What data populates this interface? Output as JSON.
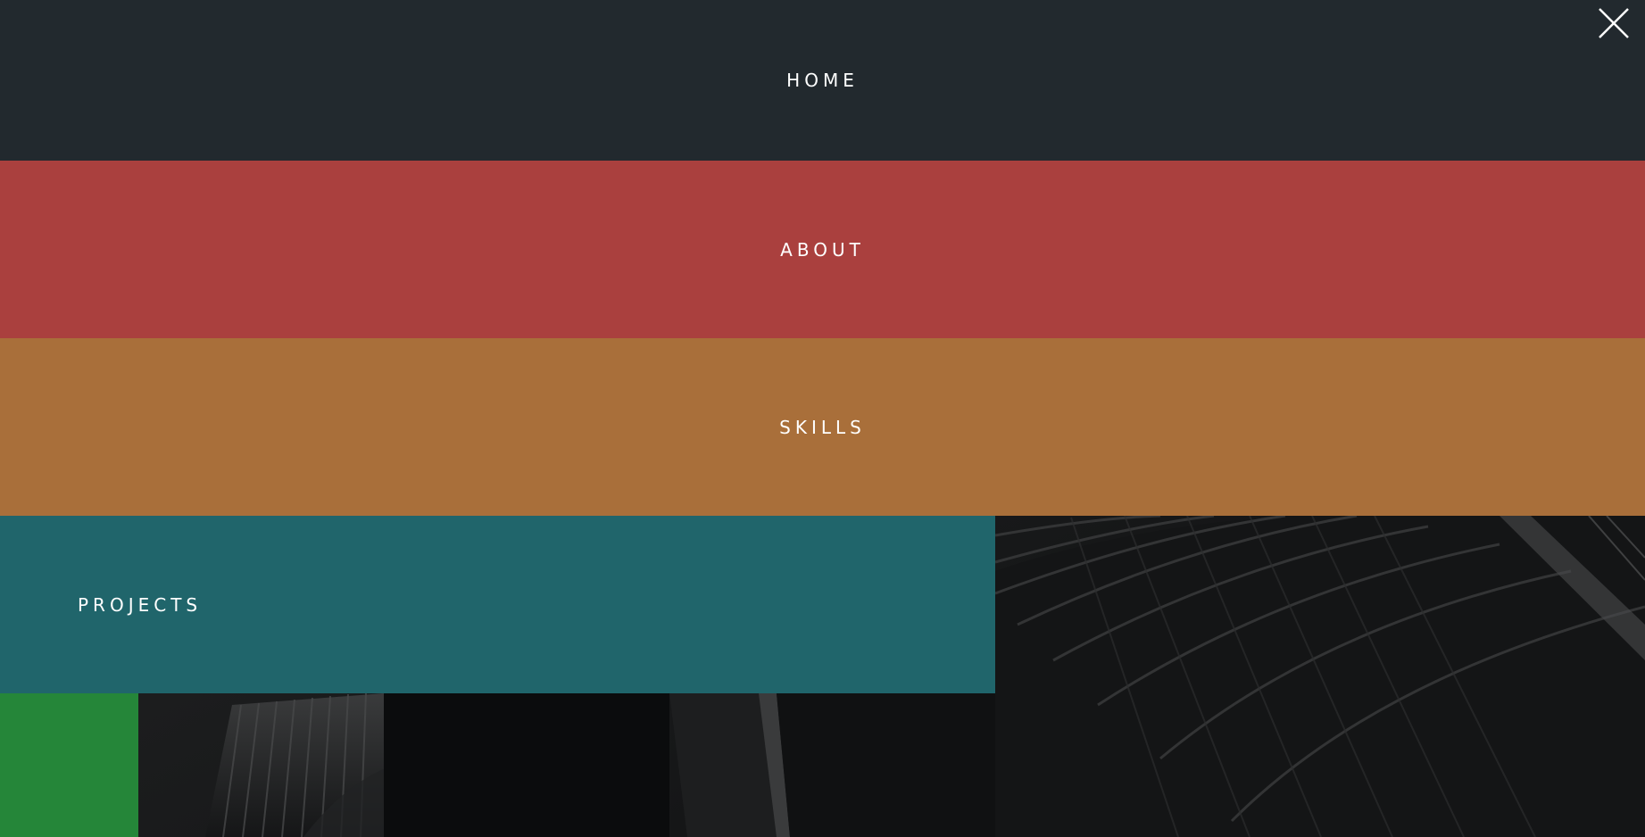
{
  "menu": {
    "items": [
      {
        "label": "HOME",
        "color": "#22292e"
      },
      {
        "label": "ABOUT",
        "color": "#aa403e"
      },
      {
        "label": "SKILLS",
        "color": "#a96f3a"
      },
      {
        "label": "PROJECTS",
        "color": "#20656b"
      },
      {
        "label": "",
        "color": "#258639"
      }
    ]
  },
  "close_icon": "close-icon",
  "colors": {
    "text": "#ffffff",
    "backdrop": "#0b0c0d"
  }
}
